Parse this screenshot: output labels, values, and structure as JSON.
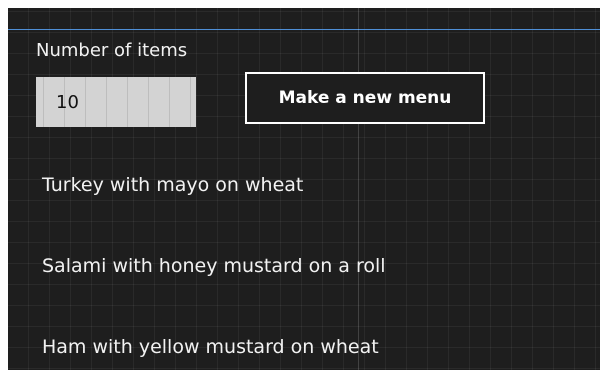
{
  "form": {
    "count_label": "Number of items",
    "count_value": "10",
    "generate_button_label": "Make a new menu"
  },
  "menu": {
    "items": [
      "Turkey with mayo on wheat",
      "Salami with honey mustard on a roll",
      "Ham with yellow mustard on wheat"
    ]
  },
  "colors": {
    "background": "#1e1e1e",
    "top_accent_line": "#4f8fd6",
    "input_background": "#d3d3d3",
    "text": "#f2f2f2",
    "button_border": "#ffffff"
  }
}
